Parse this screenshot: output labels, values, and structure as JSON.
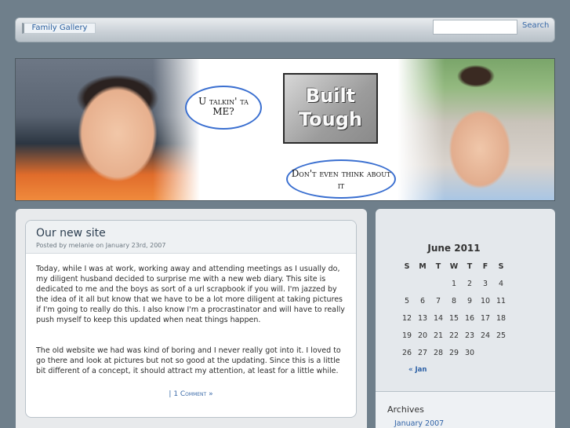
{
  "nav": {
    "tab_label": "Family Gallery",
    "search_placeholder": "",
    "search_label": "Search"
  },
  "banner": {
    "bubble_1": "U talkin' ta ME?",
    "bubble_2": "Don't even think about it",
    "sign_line_1": "Built",
    "sign_line_2": "Tough"
  },
  "post": {
    "title": "Our new site",
    "meta": "Posted by melanie on January 23rd, 2007",
    "paragraphs": [
      "Today, while I was at work, working away and attending meetings as I usually do, my diligent husband decided to surprise me with a new web diary. This site is dedicated to me and the boys as sort of a url scrapbook if you will. I'm jazzed by the idea of it all but know that we have to be a lot more diligent at taking pictures if I'm going to really do this. I also know I'm a procrastinator and will have to really push myself to keep this updated when neat things happen.",
      "The old website we had was kind of boring and I never really got into it. I loved to go there and look at pictures but not so good at the updating. Since this is a little bit different of a concept, it should attract my attention, at least for a little while."
    ],
    "comments_link": "| 1 Comment »"
  },
  "calendar": {
    "title": "June 2011",
    "weekdays": [
      "S",
      "M",
      "T",
      "W",
      "T",
      "F",
      "S"
    ],
    "weeks": [
      [
        "",
        "",
        "",
        "1",
        "2",
        "3",
        "4"
      ],
      [
        "5",
        "6",
        "7",
        "8",
        "9",
        "10",
        "11"
      ],
      [
        "12",
        "13",
        "14",
        "15",
        "16",
        "17",
        "18"
      ],
      [
        "19",
        "20",
        "21",
        "22",
        "23",
        "24",
        "25"
      ],
      [
        "26",
        "27",
        "28",
        "29",
        "30",
        "",
        ""
      ]
    ],
    "prev_link": "« Jan"
  },
  "archives": {
    "title": "Archives",
    "items": [
      "January 2007"
    ]
  }
}
